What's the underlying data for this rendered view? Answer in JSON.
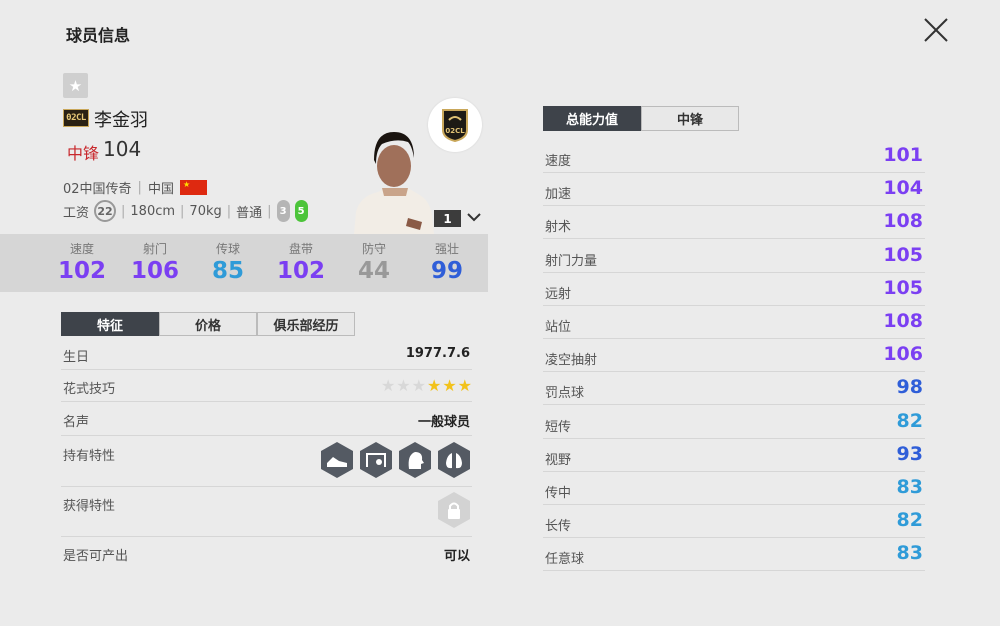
{
  "header": {
    "title": "球员信息"
  },
  "player": {
    "season": "02CL",
    "name": "李金羽",
    "position": "中锋",
    "ovr": "104",
    "card_type": "02中国传奇",
    "nation": "中国",
    "wage_label": "工资",
    "wage": "22",
    "height": "180cm",
    "weight": "70kg",
    "body_type": "普通",
    "weak_foot": "3",
    "strong_foot": "5",
    "level": "1"
  },
  "summary_stats": [
    {
      "label": "速度",
      "value": "102",
      "color": "#7b3ff2"
    },
    {
      "label": "射门",
      "value": "106",
      "color": "#7b3ff2"
    },
    {
      "label": "传球",
      "value": "85",
      "color": "#2f9bd8"
    },
    {
      "label": "盘带",
      "value": "102",
      "color": "#7b3ff2"
    },
    {
      "label": "防守",
      "value": "44",
      "color": "#999999"
    },
    {
      "label": "强壮",
      "value": "99",
      "color": "#2f5ed8"
    }
  ],
  "left_tabs": [
    "特征",
    "价格",
    "俱乐部经历"
  ],
  "details": {
    "birthday_label": "生日",
    "birthday": "1977.7.6",
    "skill_label": "花式技巧",
    "skill_stars": 3,
    "reputation_label": "名声",
    "reputation": "一般球员",
    "traits_label": "持有特性",
    "acquired_label": "获得特性",
    "producible_label": "是否可产出",
    "producible": "可以"
  },
  "right_tabs": [
    "总能力值",
    "中锋"
  ],
  "attributes": [
    {
      "label": "速度",
      "value": "101",
      "color": "#7b3ff2"
    },
    {
      "label": "加速",
      "value": "104",
      "color": "#7b3ff2"
    },
    {
      "label": "射术",
      "value": "108",
      "color": "#7b3ff2"
    },
    {
      "label": "射门力量",
      "value": "105",
      "color": "#7b3ff2"
    },
    {
      "label": "远射",
      "value": "105",
      "color": "#7b3ff2"
    },
    {
      "label": "站位",
      "value": "108",
      "color": "#7b3ff2"
    },
    {
      "label": "凌空抽射",
      "value": "106",
      "color": "#7b3ff2"
    },
    {
      "label": "罚点球",
      "value": "98",
      "color": "#2f5ed8"
    },
    {
      "label": "短传",
      "value": "82",
      "color": "#2f9bd8"
    },
    {
      "label": "视野",
      "value": "93",
      "color": "#2f5ed8"
    },
    {
      "label": "传中",
      "value": "83",
      "color": "#2f9bd8"
    },
    {
      "label": "长传",
      "value": "82",
      "color": "#2f9bd8"
    },
    {
      "label": "任意球",
      "value": "83",
      "color": "#2f9bd8"
    }
  ],
  "icons": {
    "close": "close-icon",
    "favorite": "star-icon",
    "club": "club-crest-icon",
    "dropdown": "chevron-down-icon",
    "traits": [
      "boot-icon",
      "goal-net-icon",
      "head-icon",
      "lungs-icon"
    ],
    "locked": "lock-icon"
  }
}
